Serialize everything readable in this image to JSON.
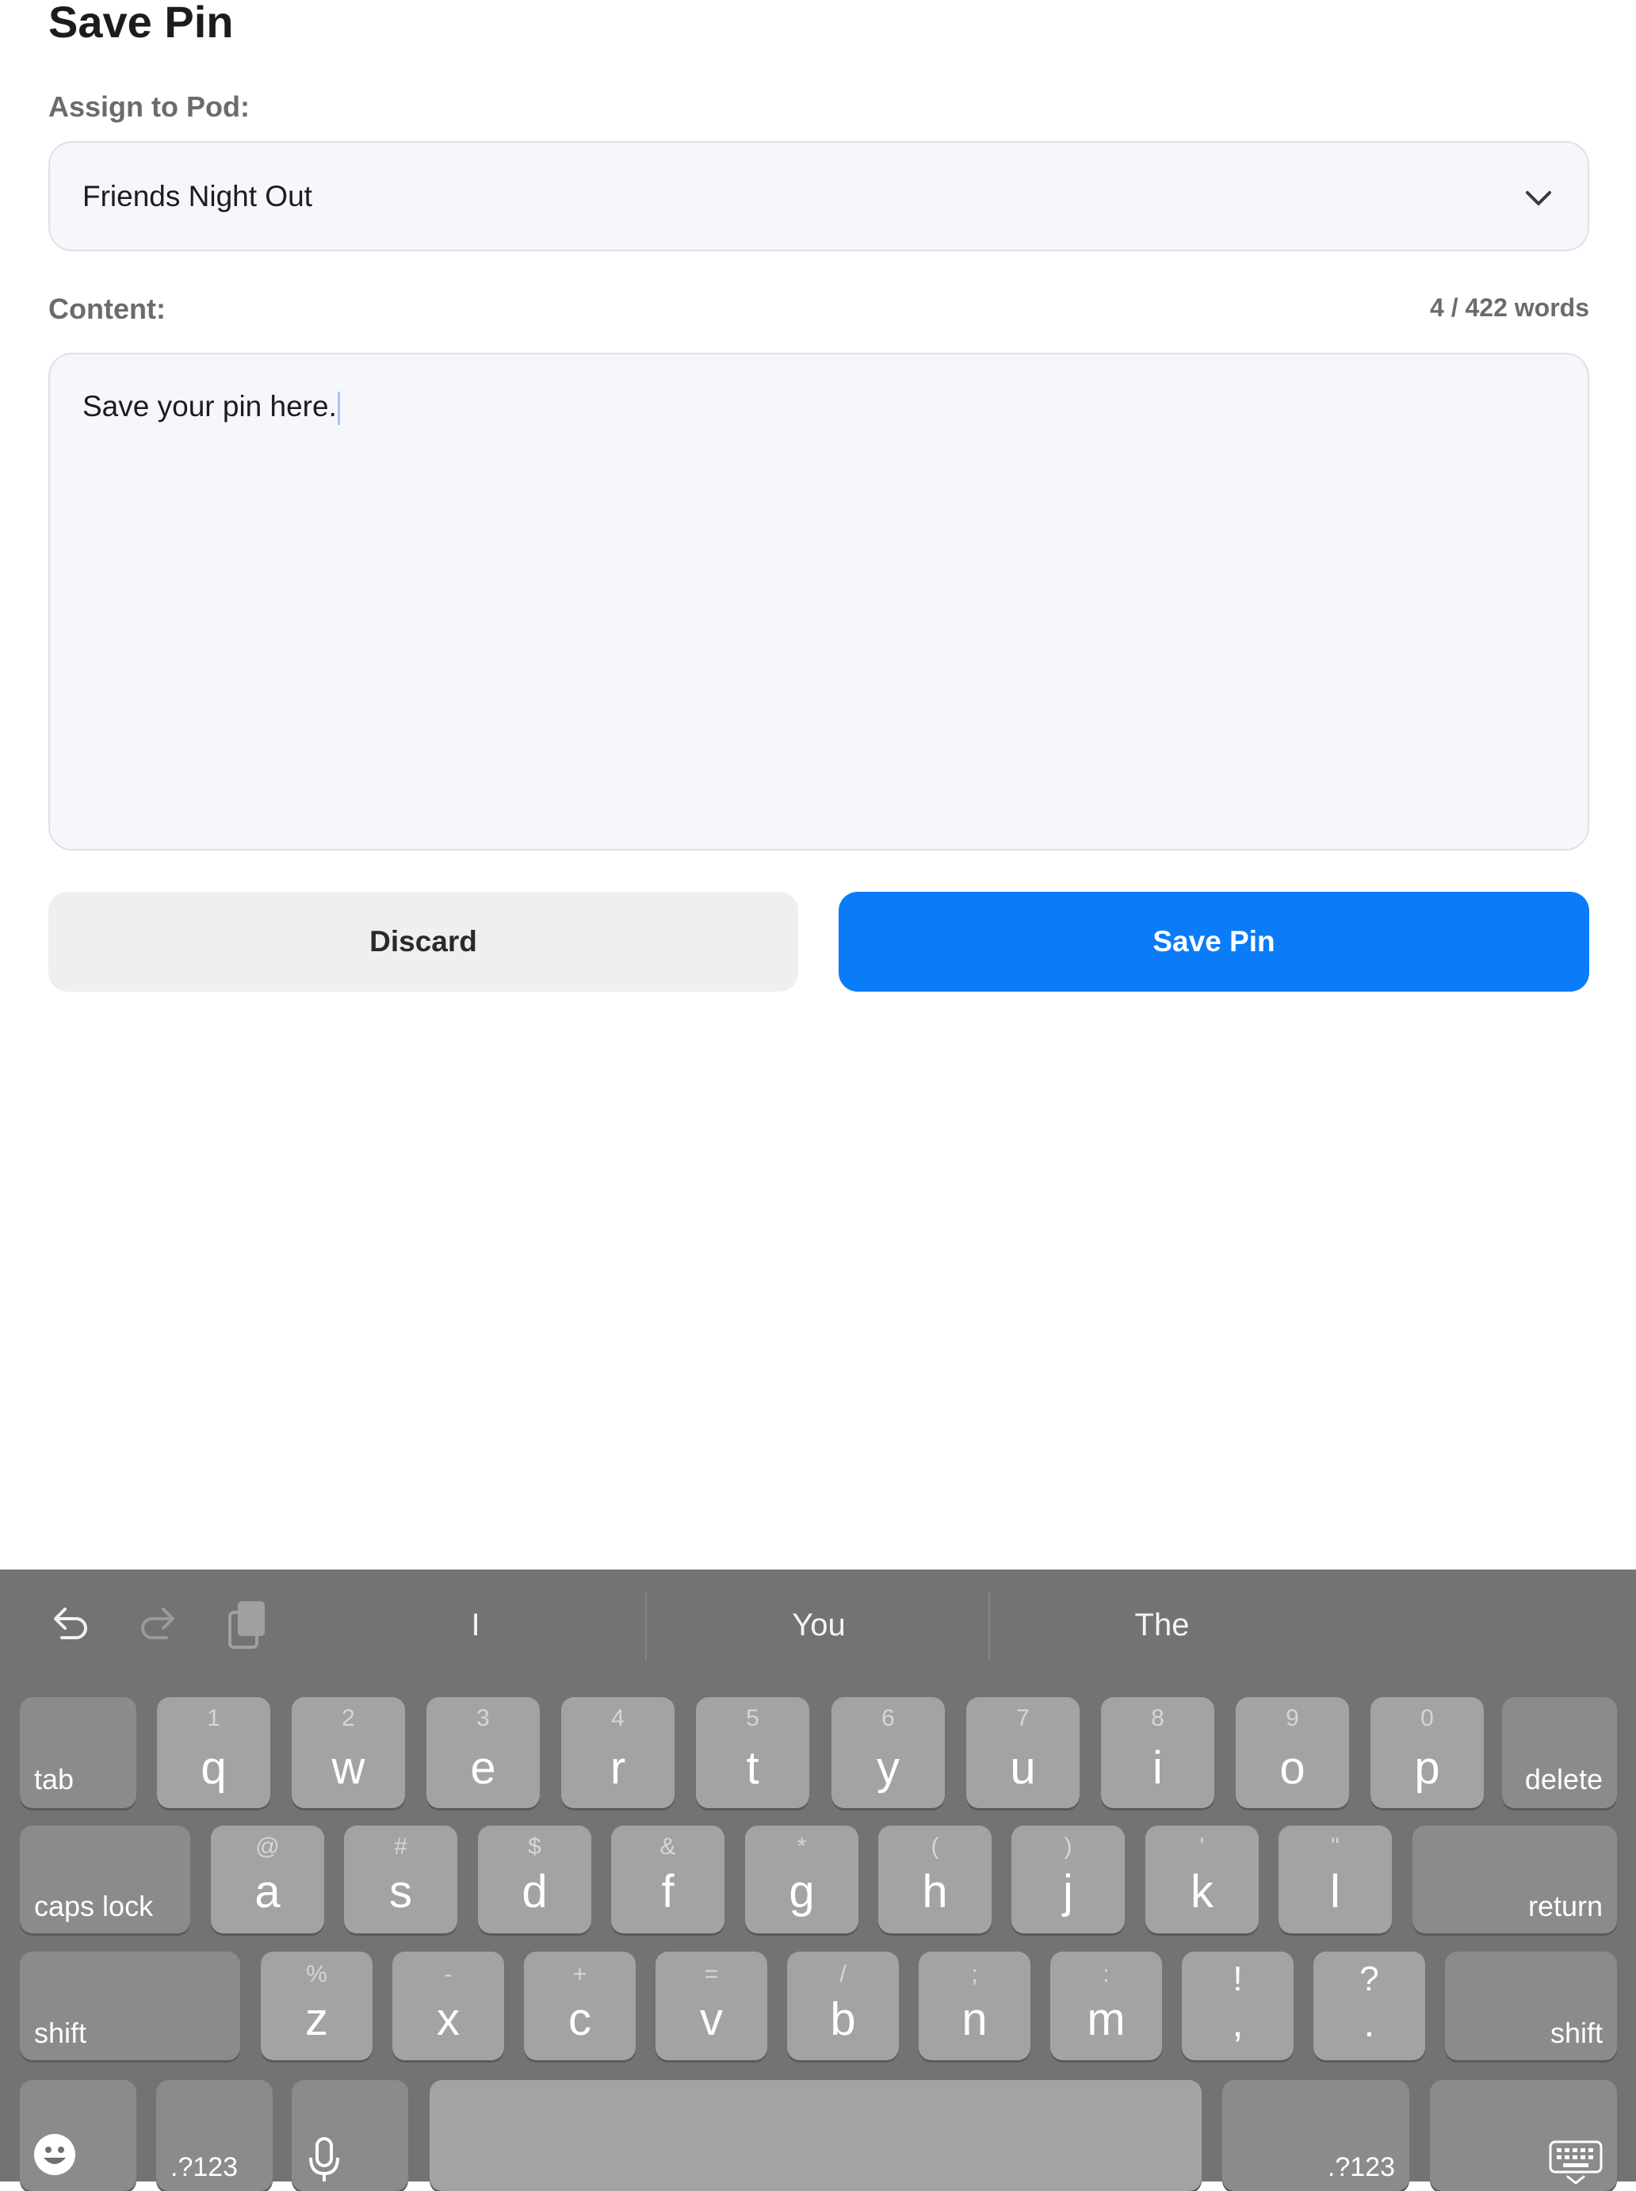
{
  "page": {
    "title": "Save Pin"
  },
  "form": {
    "pod_label": "Assign to Pod:",
    "pod_value": "Friends Night Out",
    "content_label": "Content:",
    "word_count": "4 / 422 words",
    "content_value": "Save your pin here."
  },
  "actions": {
    "discard_label": "Discard",
    "save_label": "Save Pin"
  },
  "colors": {
    "accent": "#0a7cf8",
    "field_bg": "#f6f7fb",
    "keyboard_bg": "#737373"
  },
  "keyboard": {
    "suggestions": [
      "I",
      "You",
      "The"
    ],
    "toolbar_icons": [
      "undo-icon",
      "redo-icon",
      "clipboard-icon"
    ],
    "row1": [
      {
        "main": "q",
        "alt": "1"
      },
      {
        "main": "w",
        "alt": "2"
      },
      {
        "main": "e",
        "alt": "3"
      },
      {
        "main": "r",
        "alt": "4"
      },
      {
        "main": "t",
        "alt": "5"
      },
      {
        "main": "y",
        "alt": "6"
      },
      {
        "main": "u",
        "alt": "7"
      },
      {
        "main": "i",
        "alt": "8"
      },
      {
        "main": "o",
        "alt": "9"
      },
      {
        "main": "p",
        "alt": "0"
      }
    ],
    "row2": [
      {
        "main": "a",
        "alt": "@"
      },
      {
        "main": "s",
        "alt": "#"
      },
      {
        "main": "d",
        "alt": "$"
      },
      {
        "main": "f",
        "alt": "&"
      },
      {
        "main": "g",
        "alt": "*"
      },
      {
        "main": "h",
        "alt": "("
      },
      {
        "main": "j",
        "alt": ")"
      },
      {
        "main": "k",
        "alt": "'"
      },
      {
        "main": "l",
        "alt": "\""
      }
    ],
    "row3": [
      {
        "main": "z",
        "alt": "%"
      },
      {
        "main": "x",
        "alt": "-"
      },
      {
        "main": "c",
        "alt": "+"
      },
      {
        "main": "v",
        "alt": "="
      },
      {
        "main": "b",
        "alt": "/"
      },
      {
        "main": "n",
        "alt": ";"
      },
      {
        "main": "m",
        "alt": ":"
      },
      {
        "main": ",",
        "alt": "!"
      },
      {
        "main": ".",
        "alt": "?"
      }
    ],
    "tab_label": "tab",
    "delete_label": "delete",
    "caps_label": "caps lock",
    "return_label": "return",
    "shift_label": "shift",
    "numbers_label": ".?123",
    "bottom_icons": [
      "emoji-icon",
      "microphone-icon",
      "keyboard-dismiss-icon"
    ]
  }
}
